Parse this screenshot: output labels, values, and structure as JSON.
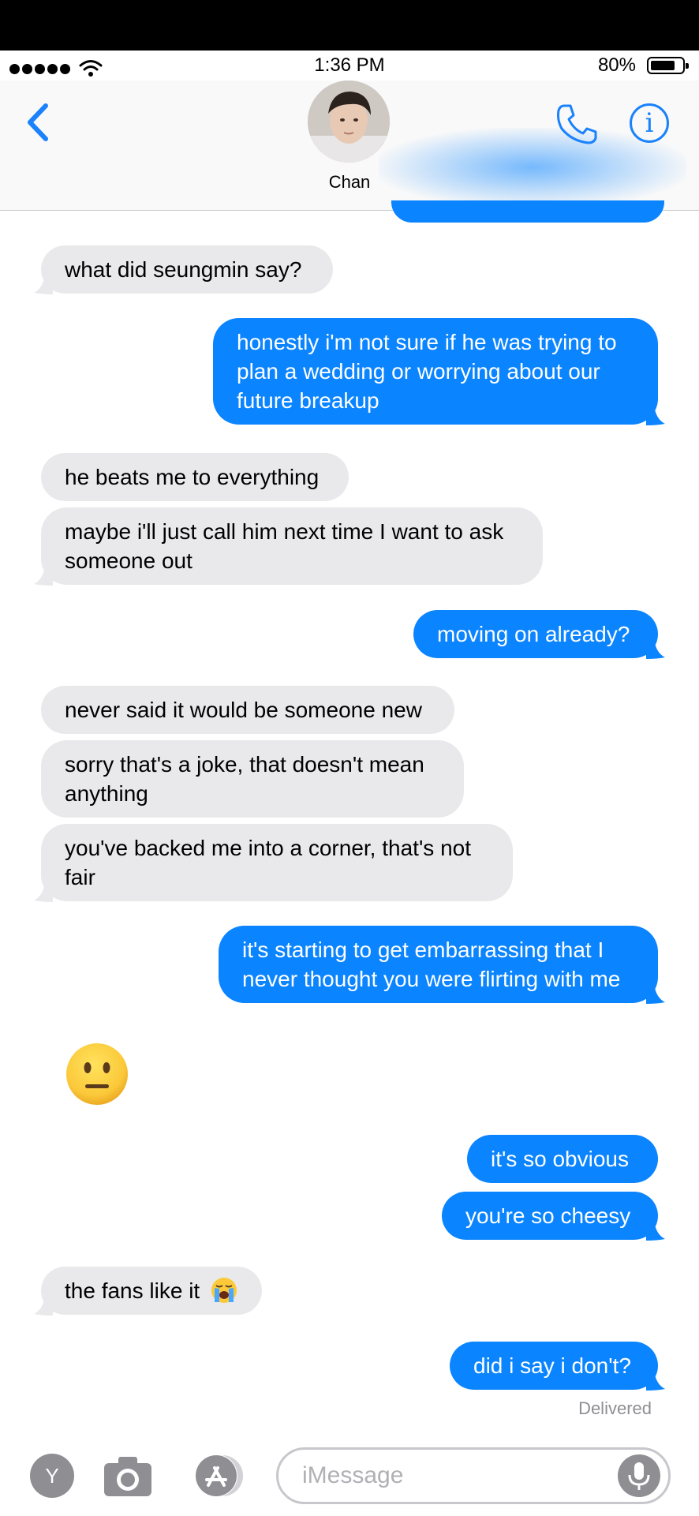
{
  "status_bar": {
    "time": "1:36 PM",
    "battery": "80%",
    "battery_level": 0.8
  },
  "header": {
    "contact_name": "Chan"
  },
  "messages": [
    {
      "dir": "in",
      "text": "what did seungmin say?"
    },
    {
      "dir": "out",
      "text": "honestly i'm not sure if he was trying to plan a wedding or worrying about our future breakup"
    },
    {
      "dir": "in",
      "text": "he beats me to everything"
    },
    {
      "dir": "in",
      "text": "maybe i'll just call him next time I want to ask someone out"
    },
    {
      "dir": "out",
      "text": "moving on already?"
    },
    {
      "dir": "in",
      "text": "never said it would be someone new"
    },
    {
      "dir": "in",
      "text": "sorry that's a joke, that doesn't mean anything"
    },
    {
      "dir": "in",
      "text": "you've backed me into a corner, that's not fair"
    },
    {
      "dir": "out",
      "text": "it's starting to get embarrassing that I never thought you were flirting with me"
    },
    {
      "dir": "in",
      "emoji": "neutral-face"
    },
    {
      "dir": "out",
      "text": "it's so obvious"
    },
    {
      "dir": "out",
      "text": "you're so cheesy"
    },
    {
      "dir": "in",
      "text": "the fans like it",
      "emoji": "loudly-crying-face"
    },
    {
      "dir": "out",
      "text": "did i say i don't?"
    }
  ],
  "delivery_status": "Delivered",
  "input_bar": {
    "apps_label": "Y",
    "placeholder": "iMessage"
  },
  "colors": {
    "outgoing": "#0a84ff",
    "incoming": "#e9e9eb",
    "accent": "#1a82fb"
  }
}
